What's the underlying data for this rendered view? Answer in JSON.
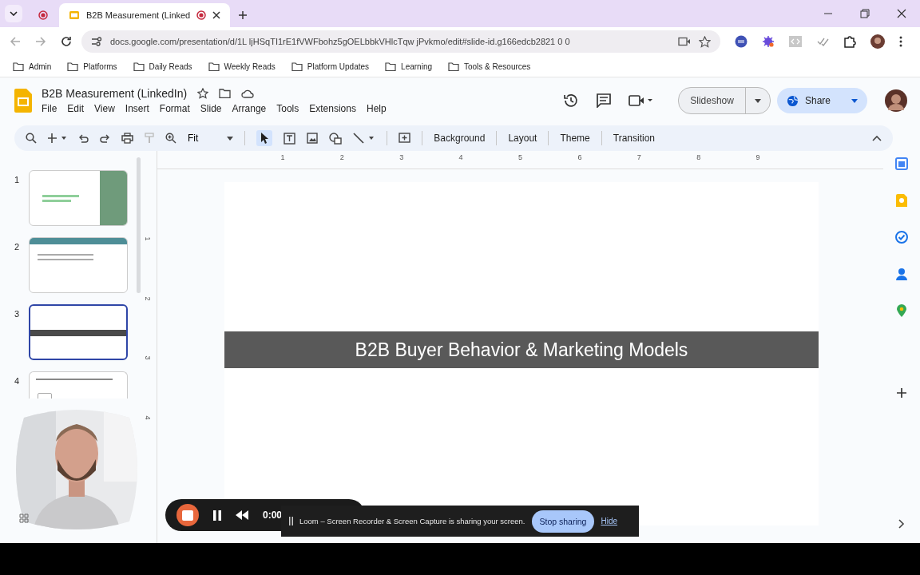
{
  "browser": {
    "tabs": [
      {
        "selected": false
      },
      {
        "title": "B2B Measurement (Linked",
        "selected": true
      }
    ],
    "url": "docs.google.com/presentation/d/1L ljHSqTI1rE1fVWFbohz5gOELbbkVHlcTqw jPvkmo/edit#slide-id.g166edcb2821 0 0",
    "bookmarks": [
      "Admin",
      "Platforms",
      "Daily Reads",
      "Weekly Reads",
      "Platform Updates",
      "Learning",
      "Tools & Resources"
    ]
  },
  "document": {
    "title": "B2B Measurement (LinkedIn)",
    "menus": [
      "File",
      "Edit",
      "View",
      "Insert",
      "Format",
      "Slide",
      "Arrange",
      "Tools",
      "Extensions",
      "Help"
    ],
    "slideshow_button": "Slideshow",
    "share_button": "Share"
  },
  "toolbar": {
    "zoom": "Fit",
    "buttons": [
      "Background",
      "Layout",
      "Theme",
      "Transition"
    ]
  },
  "ruler": {
    "horizontal": [
      "1",
      "2",
      "3",
      "4",
      "5",
      "6",
      "7",
      "8",
      "9"
    ],
    "vertical": [
      "1",
      "2",
      "3",
      "4"
    ]
  },
  "slides": [
    {
      "number": "1",
      "kind": "title-image",
      "selected": false
    },
    {
      "number": "2",
      "kind": "header-bullets",
      "selected": false
    },
    {
      "number": "3",
      "kind": "banner",
      "selected": true
    },
    {
      "number": "4",
      "kind": "text",
      "selected": false
    }
  ],
  "slide": {
    "title": "B2B Buyer Behavior & Marketing Models"
  },
  "recorder": {
    "time": "0:00",
    "message": "Loom – Screen Recorder & Screen Capture is sharing your screen.",
    "stop_button": "Stop sharing",
    "hide_link": "Hide"
  }
}
